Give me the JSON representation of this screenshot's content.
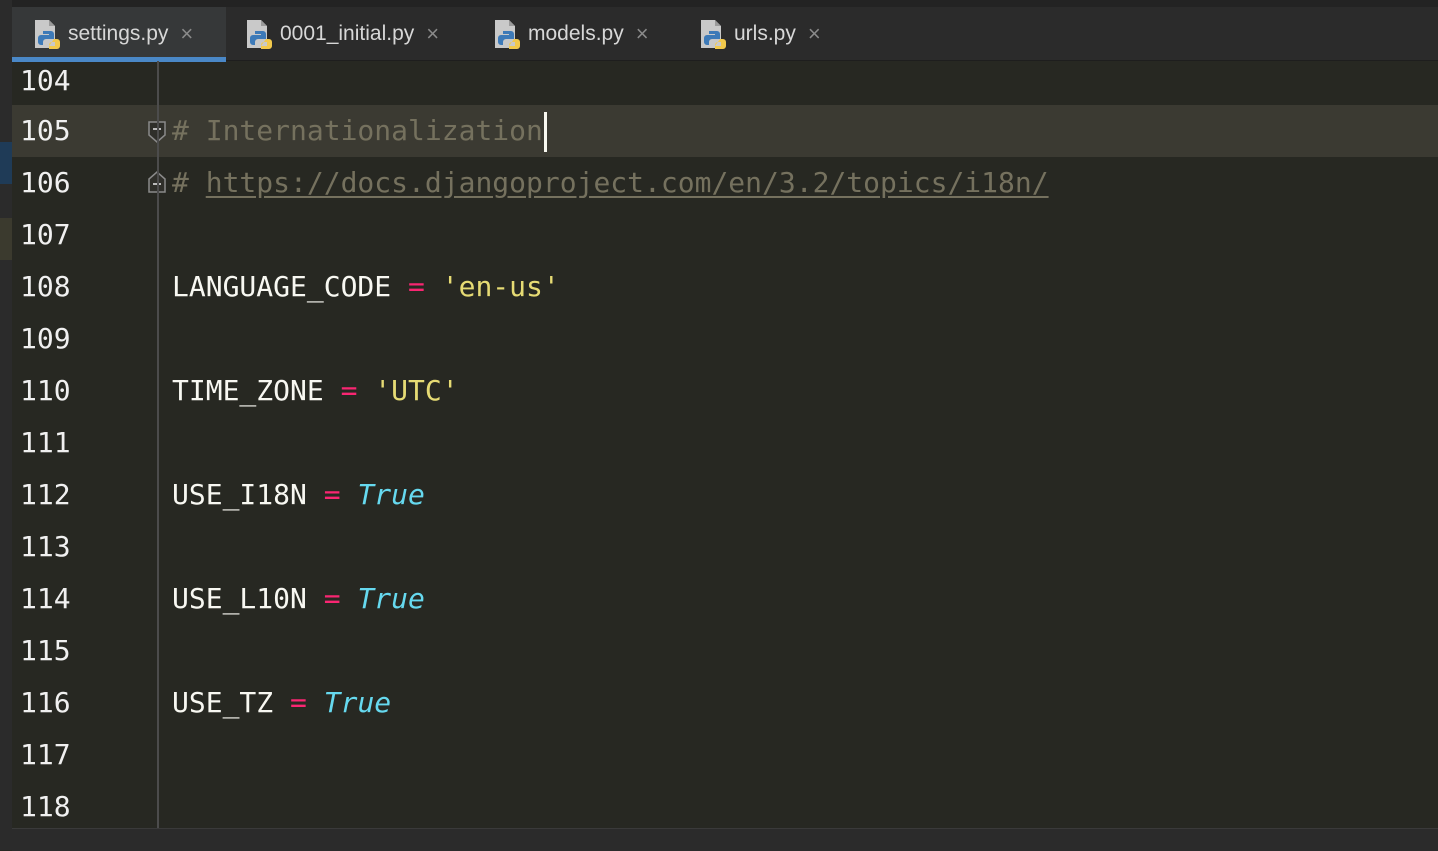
{
  "tabs": [
    {
      "label": "settings.py",
      "active": true
    },
    {
      "label": "0001_initial.py",
      "active": false
    },
    {
      "label": "models.py",
      "active": false
    },
    {
      "label": "urls.py",
      "active": false
    }
  ],
  "icons": {
    "file": "python-file-icon",
    "close": "close-icon",
    "fold": "fold-icon"
  },
  "colors": {
    "background": "#272822",
    "current_line": "#3b3a32",
    "comment": "#75715e",
    "operator": "#f92672",
    "string": "#e6db74",
    "keyword": "#66d9ef",
    "active_tab_underline": "#4a88c7"
  },
  "editor": {
    "current_line_number": "105",
    "lines": [
      {
        "n": "104"
      },
      {
        "n": "105",
        "comment": "# Internationalization"
      },
      {
        "n": "106",
        "comment_prefix": "# ",
        "link": "https://docs.djangoproject.com/en/3.2/topics/i18n/"
      },
      {
        "n": "107"
      },
      {
        "n": "108",
        "name": "LANGUAGE_CODE",
        "op": "=",
        "value": "'en-us'"
      },
      {
        "n": "109"
      },
      {
        "n": "110",
        "name": "TIME_ZONE",
        "op": "=",
        "value": "'UTC'"
      },
      {
        "n": "111"
      },
      {
        "n": "112",
        "name": "USE_I18N",
        "op": "=",
        "value": "True"
      },
      {
        "n": "113"
      },
      {
        "n": "114",
        "name": "USE_L10N",
        "op": "=",
        "value": "True"
      },
      {
        "n": "115"
      },
      {
        "n": "116",
        "name": "USE_TZ",
        "op": "=",
        "value": "True"
      },
      {
        "n": "117"
      },
      {
        "n": "118"
      }
    ]
  }
}
